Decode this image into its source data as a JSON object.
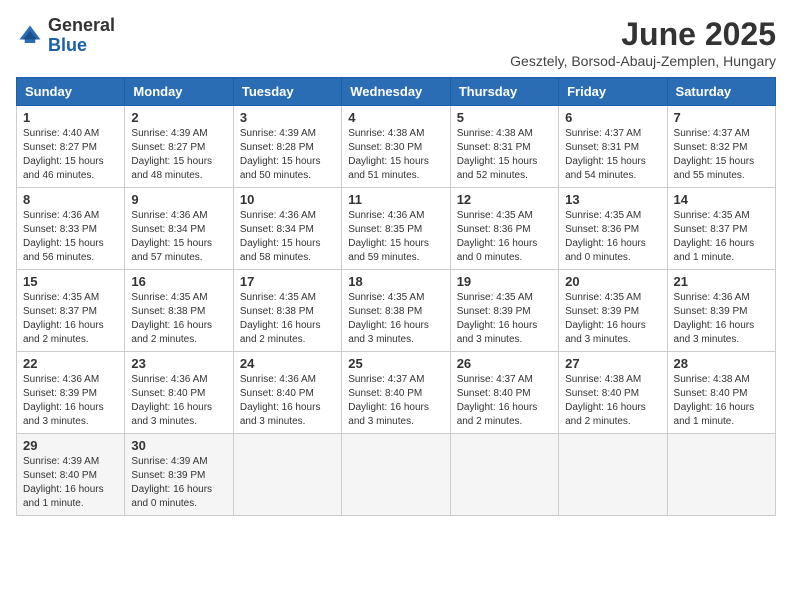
{
  "logo": {
    "general": "General",
    "blue": "Blue"
  },
  "title": "June 2025",
  "location": "Gesztely, Borsod-Abauj-Zemplen, Hungary",
  "days_of_week": [
    "Sunday",
    "Monday",
    "Tuesday",
    "Wednesday",
    "Thursday",
    "Friday",
    "Saturday"
  ],
  "weeks": [
    [
      {
        "day": "1",
        "sunrise": "Sunrise: 4:40 AM",
        "sunset": "Sunset: 8:27 PM",
        "daylight": "Daylight: 15 hours and 46 minutes."
      },
      {
        "day": "2",
        "sunrise": "Sunrise: 4:39 AM",
        "sunset": "Sunset: 8:27 PM",
        "daylight": "Daylight: 15 hours and 48 minutes."
      },
      {
        "day": "3",
        "sunrise": "Sunrise: 4:39 AM",
        "sunset": "Sunset: 8:28 PM",
        "daylight": "Daylight: 15 hours and 50 minutes."
      },
      {
        "day": "4",
        "sunrise": "Sunrise: 4:38 AM",
        "sunset": "Sunset: 8:30 PM",
        "daylight": "Daylight: 15 hours and 51 minutes."
      },
      {
        "day": "5",
        "sunrise": "Sunrise: 4:38 AM",
        "sunset": "Sunset: 8:31 PM",
        "daylight": "Daylight: 15 hours and 52 minutes."
      },
      {
        "day": "6",
        "sunrise": "Sunrise: 4:37 AM",
        "sunset": "Sunset: 8:31 PM",
        "daylight": "Daylight: 15 hours and 54 minutes."
      },
      {
        "day": "7",
        "sunrise": "Sunrise: 4:37 AM",
        "sunset": "Sunset: 8:32 PM",
        "daylight": "Daylight: 15 hours and 55 minutes."
      }
    ],
    [
      {
        "day": "8",
        "sunrise": "Sunrise: 4:36 AM",
        "sunset": "Sunset: 8:33 PM",
        "daylight": "Daylight: 15 hours and 56 minutes."
      },
      {
        "day": "9",
        "sunrise": "Sunrise: 4:36 AM",
        "sunset": "Sunset: 8:34 PM",
        "daylight": "Daylight: 15 hours and 57 minutes."
      },
      {
        "day": "10",
        "sunrise": "Sunrise: 4:36 AM",
        "sunset": "Sunset: 8:34 PM",
        "daylight": "Daylight: 15 hours and 58 minutes."
      },
      {
        "day": "11",
        "sunrise": "Sunrise: 4:36 AM",
        "sunset": "Sunset: 8:35 PM",
        "daylight": "Daylight: 15 hours and 59 minutes."
      },
      {
        "day": "12",
        "sunrise": "Sunrise: 4:35 AM",
        "sunset": "Sunset: 8:36 PM",
        "daylight": "Daylight: 16 hours and 0 minutes."
      },
      {
        "day": "13",
        "sunrise": "Sunrise: 4:35 AM",
        "sunset": "Sunset: 8:36 PM",
        "daylight": "Daylight: 16 hours and 0 minutes."
      },
      {
        "day": "14",
        "sunrise": "Sunrise: 4:35 AM",
        "sunset": "Sunset: 8:37 PM",
        "daylight": "Daylight: 16 hours and 1 minute."
      }
    ],
    [
      {
        "day": "15",
        "sunrise": "Sunrise: 4:35 AM",
        "sunset": "Sunset: 8:37 PM",
        "daylight": "Daylight: 16 hours and 2 minutes."
      },
      {
        "day": "16",
        "sunrise": "Sunrise: 4:35 AM",
        "sunset": "Sunset: 8:38 PM",
        "daylight": "Daylight: 16 hours and 2 minutes."
      },
      {
        "day": "17",
        "sunrise": "Sunrise: 4:35 AM",
        "sunset": "Sunset: 8:38 PM",
        "daylight": "Daylight: 16 hours and 2 minutes."
      },
      {
        "day": "18",
        "sunrise": "Sunrise: 4:35 AM",
        "sunset": "Sunset: 8:38 PM",
        "daylight": "Daylight: 16 hours and 3 minutes."
      },
      {
        "day": "19",
        "sunrise": "Sunrise: 4:35 AM",
        "sunset": "Sunset: 8:39 PM",
        "daylight": "Daylight: 16 hours and 3 minutes."
      },
      {
        "day": "20",
        "sunrise": "Sunrise: 4:35 AM",
        "sunset": "Sunset: 8:39 PM",
        "daylight": "Daylight: 16 hours and 3 minutes."
      },
      {
        "day": "21",
        "sunrise": "Sunrise: 4:36 AM",
        "sunset": "Sunset: 8:39 PM",
        "daylight": "Daylight: 16 hours and 3 minutes."
      }
    ],
    [
      {
        "day": "22",
        "sunrise": "Sunrise: 4:36 AM",
        "sunset": "Sunset: 8:39 PM",
        "daylight": "Daylight: 16 hours and 3 minutes."
      },
      {
        "day": "23",
        "sunrise": "Sunrise: 4:36 AM",
        "sunset": "Sunset: 8:40 PM",
        "daylight": "Daylight: 16 hours and 3 minutes."
      },
      {
        "day": "24",
        "sunrise": "Sunrise: 4:36 AM",
        "sunset": "Sunset: 8:40 PM",
        "daylight": "Daylight: 16 hours and 3 minutes."
      },
      {
        "day": "25",
        "sunrise": "Sunrise: 4:37 AM",
        "sunset": "Sunset: 8:40 PM",
        "daylight": "Daylight: 16 hours and 3 minutes."
      },
      {
        "day": "26",
        "sunrise": "Sunrise: 4:37 AM",
        "sunset": "Sunset: 8:40 PM",
        "daylight": "Daylight: 16 hours and 2 minutes."
      },
      {
        "day": "27",
        "sunrise": "Sunrise: 4:38 AM",
        "sunset": "Sunset: 8:40 PM",
        "daylight": "Daylight: 16 hours and 2 minutes."
      },
      {
        "day": "28",
        "sunrise": "Sunrise: 4:38 AM",
        "sunset": "Sunset: 8:40 PM",
        "daylight": "Daylight: 16 hours and 1 minute."
      }
    ],
    [
      {
        "day": "29",
        "sunrise": "Sunrise: 4:39 AM",
        "sunset": "Sunset: 8:40 PM",
        "daylight": "Daylight: 16 hours and 1 minute."
      },
      {
        "day": "30",
        "sunrise": "Sunrise: 4:39 AM",
        "sunset": "Sunset: 8:39 PM",
        "daylight": "Daylight: 16 hours and 0 minutes."
      },
      null,
      null,
      null,
      null,
      null
    ]
  ]
}
